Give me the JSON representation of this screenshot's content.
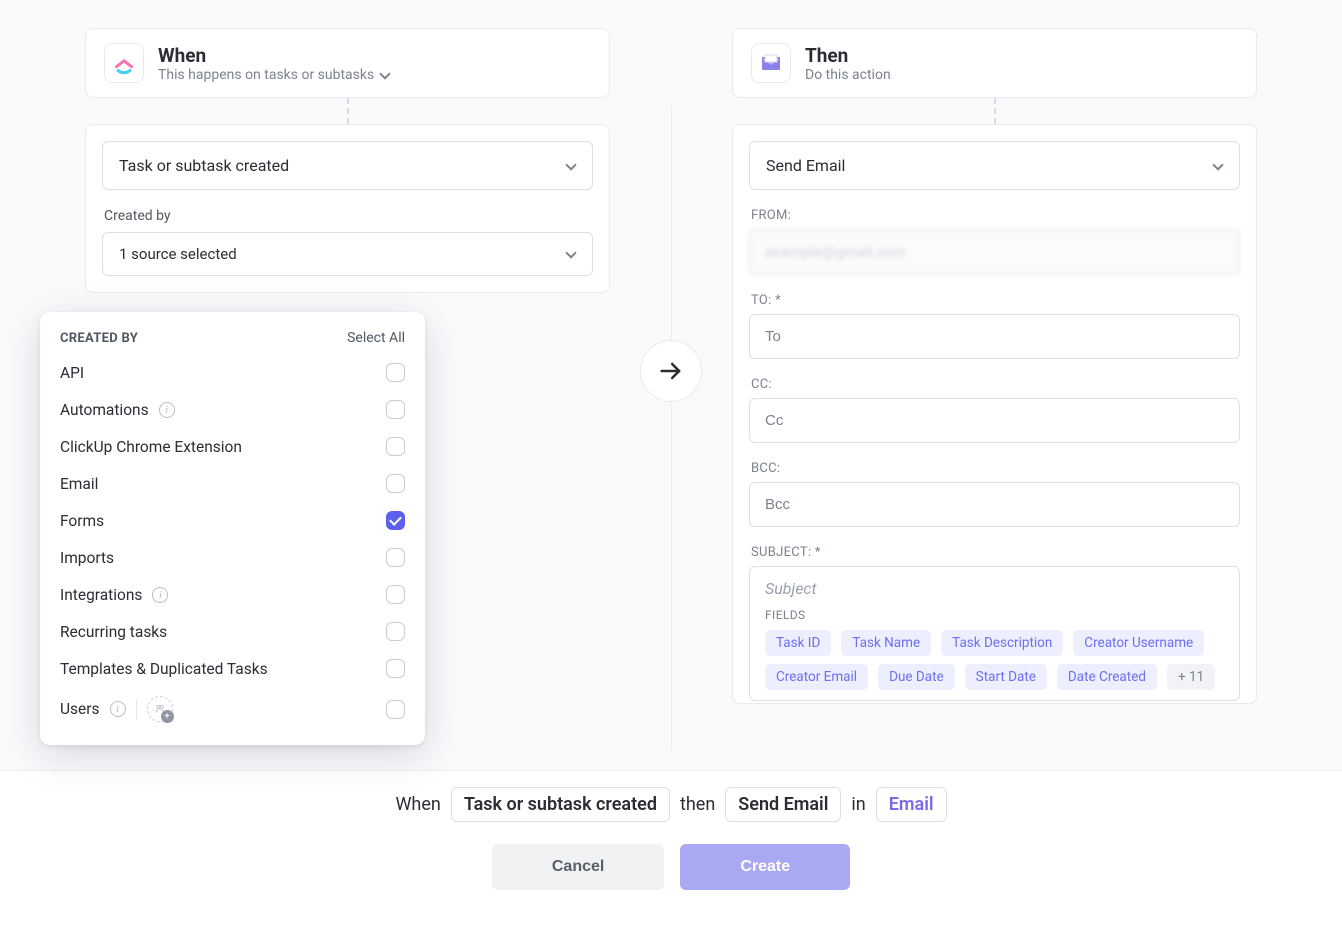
{
  "when": {
    "title": "When",
    "subtitle": "This happens on tasks or subtasks",
    "trigger": "Task or subtask created",
    "filterLabel": "Created by",
    "filterSummary": "1 source selected"
  },
  "createdByPanel": {
    "title": "CREATED BY",
    "selectAll": "Select All",
    "options": [
      {
        "label": "API",
        "checked": false,
        "info": false
      },
      {
        "label": "Automations",
        "checked": false,
        "info": true
      },
      {
        "label": "ClickUp Chrome Extension",
        "checked": false,
        "info": false
      },
      {
        "label": "Email",
        "checked": false,
        "info": false
      },
      {
        "label": "Forms",
        "checked": true,
        "info": false
      },
      {
        "label": "Imports",
        "checked": false,
        "info": false
      },
      {
        "label": "Integrations",
        "checked": false,
        "info": true
      },
      {
        "label": "Recurring tasks",
        "checked": false,
        "info": false
      },
      {
        "label": "Templates & Duplicated Tasks",
        "checked": false,
        "info": false
      },
      {
        "label": "Users",
        "checked": false,
        "info": true,
        "userAdd": true
      }
    ]
  },
  "then": {
    "title": "Then",
    "subtitle": "Do this action",
    "action": "Send Email",
    "fromLabel": "FROM:",
    "fromValue": "example@gmail.com",
    "toLabel": "TO: *",
    "toPlaceholder": "To",
    "ccLabel": "CC:",
    "ccPlaceholder": "Cc",
    "bccLabel": "BCC:",
    "bccPlaceholder": "Bcc",
    "subjectLabel": "SUBJECT: *",
    "subjectPlaceholder": "Subject",
    "fieldsTitle": "FIELDS",
    "fields": [
      "Task ID",
      "Task Name",
      "Task Description",
      "Creator Username",
      "Creator Email",
      "Due Date",
      "Start Date",
      "Date Created"
    ],
    "fieldsMore": "+ 11"
  },
  "summary": {
    "whenText": "When",
    "trigger": "Task or subtask created",
    "thenText": "then",
    "action": "Send Email",
    "inText": "in",
    "location": "Email"
  },
  "buttons": {
    "cancel": "Cancel",
    "create": "Create"
  }
}
